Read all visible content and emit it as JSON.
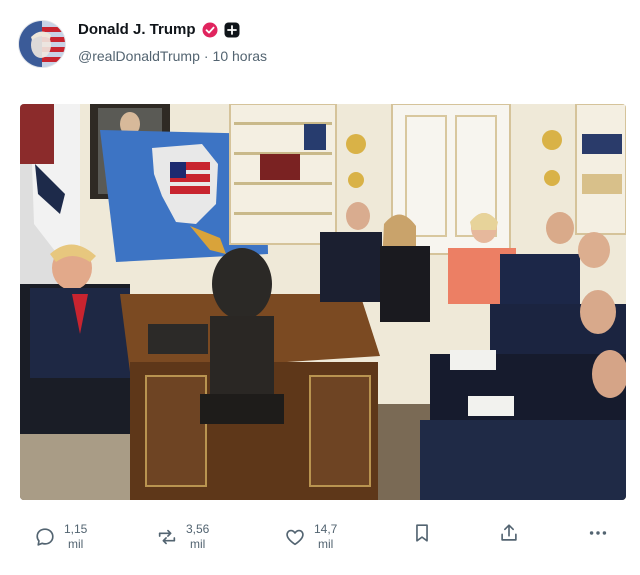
{
  "post": {
    "author": {
      "display_name": "Donald J. Trump",
      "handle": "@realDonaldTrump",
      "separator": "·",
      "time_ago": "10 horas"
    },
    "media": {
      "alt": ""
    }
  },
  "actions": {
    "replies": {
      "value": "1,15",
      "unit": "mil"
    },
    "reposts": {
      "value": "3,56",
      "unit": "mil"
    },
    "likes": {
      "value": "14,7",
      "unit": "mil"
    }
  },
  "colors": {
    "verified_badge": "#e0245e",
    "secondary_text": "#536471",
    "primary_text": "#0f1419"
  },
  "icons": [
    "verified-badge-icon",
    "plus-icon",
    "reply-icon",
    "repost-icon",
    "like-icon",
    "bookmark-icon",
    "share-icon",
    "more-icon"
  ]
}
